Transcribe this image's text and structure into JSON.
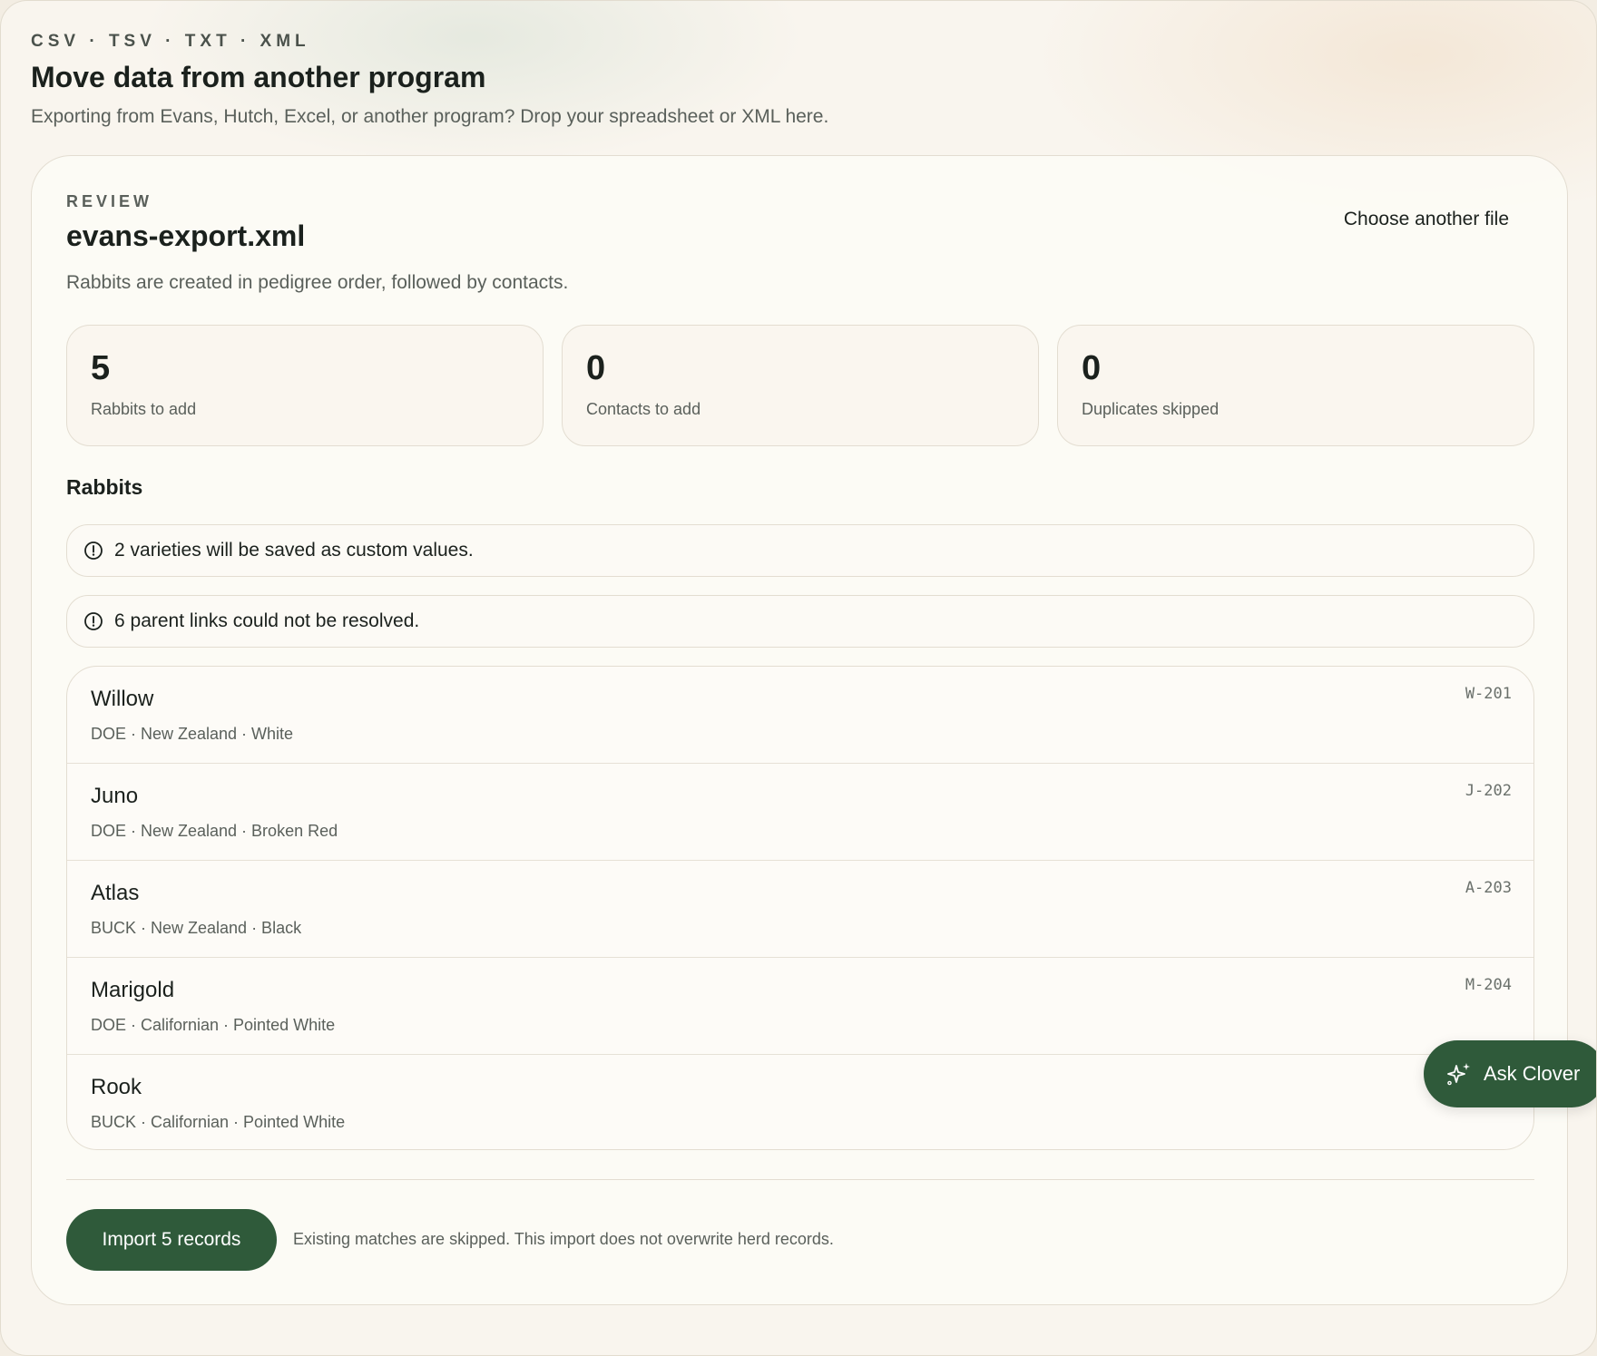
{
  "header": {
    "eyebrow": "CSV · TSV · TXT · XML",
    "title": "Move data from another program",
    "subtitle": "Exporting from Evans, Hutch, Excel, or another program? Drop your spreadsheet or XML here."
  },
  "review": {
    "label": "REVIEW",
    "file_name": "evans-export.xml",
    "description": "Rabbits are created in pedigree order, followed by contacts.",
    "choose_another_label": "Choose another file"
  },
  "stats": [
    {
      "value": "5",
      "label": "Rabbits to add"
    },
    {
      "value": "0",
      "label": "Contacts to add"
    },
    {
      "value": "0",
      "label": "Duplicates skipped"
    }
  ],
  "rabbits_section": {
    "heading": "Rabbits",
    "notices": [
      {
        "icon": "alert-circle-icon",
        "text": "2 varieties will be saved as custom values."
      },
      {
        "icon": "alert-circle-icon",
        "text": "6 parent links could not be resolved."
      }
    ],
    "rows": [
      {
        "name": "Willow",
        "meta": "DOE · New Zealand · White",
        "tag": "W-201"
      },
      {
        "name": "Juno",
        "meta": "DOE · New Zealand · Broken Red",
        "tag": "J-202"
      },
      {
        "name": "Atlas",
        "meta": "BUCK · New Zealand · Black",
        "tag": "A-203"
      },
      {
        "name": "Marigold",
        "meta": "DOE · Californian · Pointed White",
        "tag": "M-204"
      },
      {
        "name": "Rook",
        "meta": "BUCK · Californian · Pointed White",
        "tag": ""
      }
    ]
  },
  "footer": {
    "import_label": "Import 5 records",
    "note": "Existing matches are skipped. This import does not overwrite herd records."
  },
  "assistant": {
    "label": "Ask Clover",
    "icon": "sparkles-icon"
  },
  "colors": {
    "accent": "#2f5a3a",
    "background": "#f9f5ee",
    "text": "#1b211d",
    "muted": "#5a605b"
  }
}
